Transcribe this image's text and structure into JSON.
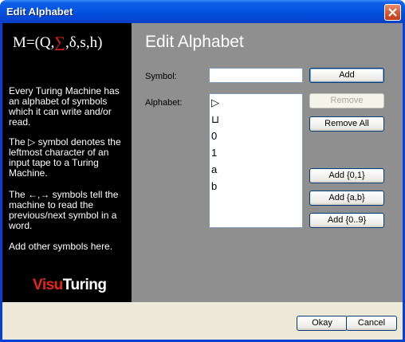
{
  "window": {
    "title": "Edit Alphabet"
  },
  "side_panel": {
    "formula": {
      "prefix": "M=(Q,",
      "sigma": "∑",
      "suffix": ",δ,s,h)"
    },
    "paragraphs": [
      "Every Turing Machine has an alphabet of symbols which it can write and/or read.",
      "The ▷ symbol denotes the leftmost character of an input tape to a Turing Machine.",
      "The ←,→ symbols tell the machine to read the previous/next symbol in a word.",
      "Add other symbols here."
    ],
    "brand": {
      "part1": "Visu",
      "part2": "Turing"
    },
    "colors": {
      "accent": "#e8231e",
      "background": "#000000"
    }
  },
  "main": {
    "title": "Edit Alphabet",
    "symbol_label": "Symbol:",
    "symbol_value": "",
    "alphabet_label": "Alphabet:",
    "alphabet_items": [
      "▷",
      "⊔",
      "0",
      "1",
      "a",
      "b"
    ],
    "buttons": {
      "add": "Add",
      "remove": "Remove",
      "remove_all": "Remove All",
      "add_01": "Add {0,1}",
      "add_ab": "Add {a,b}",
      "add_09": "Add {0..9}"
    },
    "colors": {
      "background": "#8f8f8f"
    }
  },
  "footer": {
    "okay": "Okay",
    "cancel": "Cancel"
  }
}
